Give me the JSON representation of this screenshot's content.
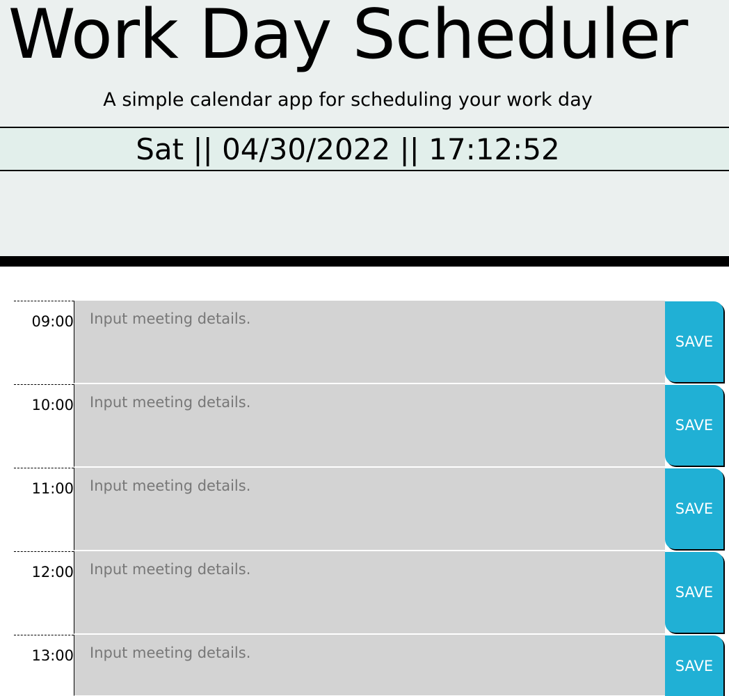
{
  "header": {
    "title": "Work Day Scheduler",
    "subtitle": "A simple calendar app for scheduling your work day",
    "current_datetime": "Sat || 04/30/2022 || 17:12:52"
  },
  "schedule": {
    "placeholder": "Input meeting details.",
    "save_label": "SAVE",
    "hours": [
      {
        "label": "09:00",
        "value": ""
      },
      {
        "label": "10:00",
        "value": ""
      },
      {
        "label": "11:00",
        "value": ""
      },
      {
        "label": "12:00",
        "value": ""
      },
      {
        "label": "13:00",
        "value": ""
      }
    ]
  },
  "colors": {
    "header_bg": "#ebf0ef",
    "datebar_bg": "#e2efeb",
    "past_row_bg": "#d3d3d3",
    "save_button": "#20b0d5"
  }
}
